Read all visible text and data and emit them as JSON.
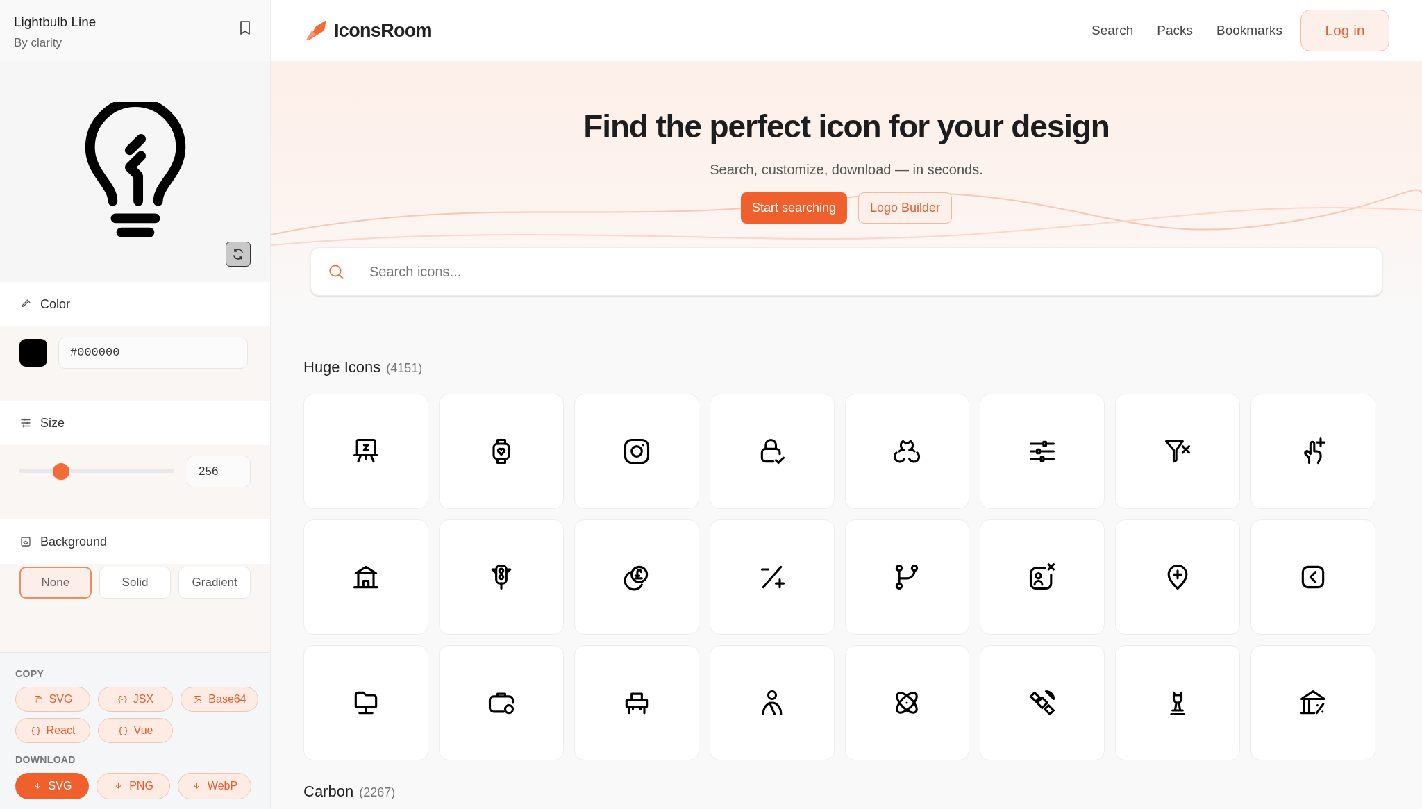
{
  "detail_panel": {
    "title": "Lightbulb Line",
    "author": "By clarity",
    "color": {
      "label": "Color",
      "value": "#000000"
    },
    "size": {
      "label": "Size",
      "level": 0.27,
      "value": "256"
    },
    "background": {
      "label": "Background",
      "options": [
        {
          "label": "None",
          "selected": true
        },
        {
          "label": "Solid",
          "selected": false
        },
        {
          "label": "Gradient",
          "selected": false
        }
      ]
    },
    "copy": {
      "heading": "COPY",
      "buttons": [
        {
          "label": "SVG",
          "kind": "copy"
        },
        {
          "label": "JSX",
          "kind": "code"
        },
        {
          "label": "Base64",
          "kind": "image"
        },
        {
          "label": "React",
          "kind": "code"
        },
        {
          "label": "Vue",
          "kind": "code"
        }
      ]
    },
    "download": {
      "heading": "DOWNLOAD",
      "buttons": [
        {
          "label": "SVG",
          "primary": true
        },
        {
          "label": "PNG",
          "primary": false
        },
        {
          "label": "WebP",
          "primary": false
        }
      ]
    }
  },
  "header": {
    "logo": "IconsRoom",
    "nav": [
      "Search",
      "Packs",
      "Bookmarks"
    ],
    "login": "Log in"
  },
  "hero": {
    "title": "Find the perfect icon for your design",
    "subtitle": "Search, customize, download — in seconds.",
    "buttons": [
      {
        "label": "Start searching",
        "primary": true
      },
      {
        "label": "Logo Builder",
        "primary": false
      }
    ]
  },
  "search": {
    "placeholder": "Search icons..."
  },
  "sections": [
    {
      "title": "Huge Icons",
      "count": "(4151)"
    },
    {
      "title": "Carbon",
      "count": "(2267)"
    }
  ]
}
